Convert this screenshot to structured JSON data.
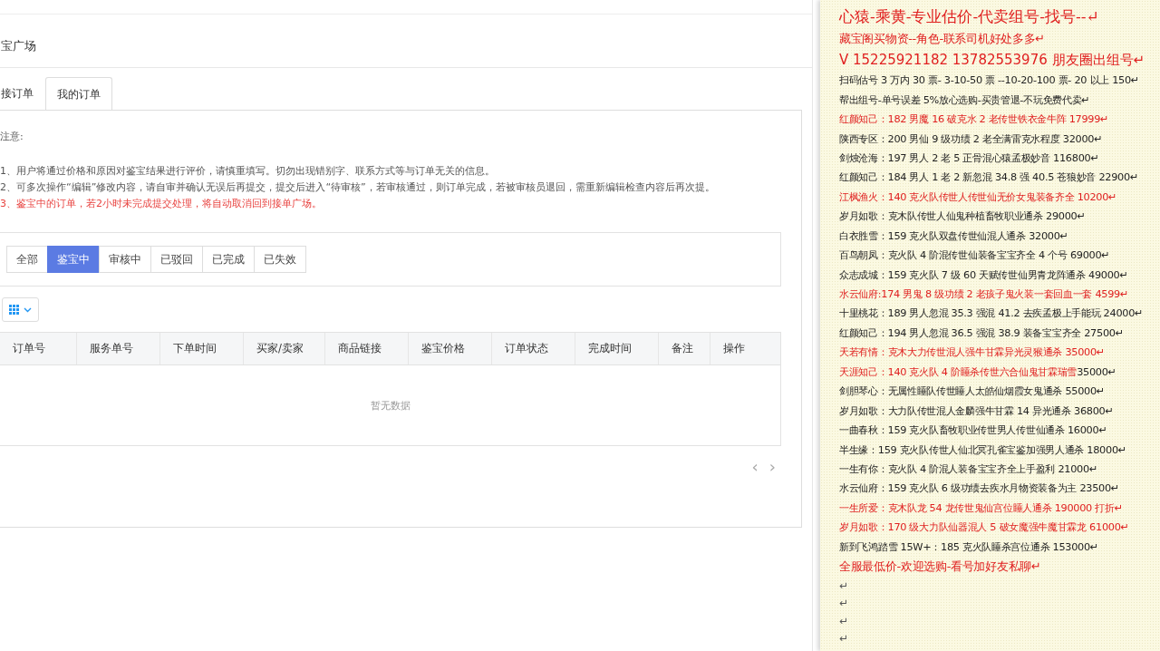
{
  "page": {
    "title": "宝广场"
  },
  "tabs": [
    {
      "label": "接订单",
      "selected": false
    },
    {
      "label": "我的订单",
      "selected": true
    }
  ],
  "notice": {
    "heading": "注意:",
    "items": [
      {
        "text": "1、用户将通过价格和原因对鉴宝结果进行评价，请慎重填写。切勿出现错别字、联系方式等与订单无关的信息。",
        "kind": "normal"
      },
      {
        "text": "2、可多次操作“编辑”修改内容，请自审并确认无误后再提交，提交后进入“待审核”，若审核通过，则订单完成，若被审核员退回，需重新编辑检查内容后再次提。",
        "kind": "normal"
      },
      {
        "text": "3、鉴宝中的订单，若2小时未完成提交处理，将自动取消回到接单广场。",
        "kind": "warning"
      }
    ]
  },
  "filters": [
    {
      "label": "全部",
      "selected": false
    },
    {
      "label": "鉴宝中",
      "selected": true
    },
    {
      "label": "审核中",
      "selected": false
    },
    {
      "label": "已驳回",
      "selected": false
    },
    {
      "label": "已完成",
      "selected": false
    },
    {
      "label": "已失效",
      "selected": false
    }
  ],
  "table": {
    "columns": [
      "订单号",
      "服务单号",
      "下单时间",
      "买家/卖家",
      "商品链接",
      "鉴宝价格",
      "订单状态",
      "完成时间",
      "备注",
      "操作"
    ],
    "empty_text": "暂无数据"
  },
  "pager": {
    "prev": "‹",
    "next": "›",
    "disabled": true
  },
  "document": {
    "lines": [
      {
        "text": "心猿-乘黄-专业估价-代卖组号-找号--↵",
        "color": "#e02020",
        "kind": "title"
      },
      {
        "text": "藏宝阁买物资--角色-联系司机好处多多↵",
        "color": "#e02020",
        "kind": "medium"
      },
      {
        "text": "V 15225921182    13782553976 朋友圈出组号↵",
        "color": "#e02020",
        "kind": "large"
      },
      {
        "text": "扫码估号 3 万内 30 票- 3-10-50 票  --10-20-100 票- 20 以上 150↵",
        "color": "#222222",
        "kind": "body"
      },
      {
        "text": "帮出组号-单号误差 5%放心选购-买贵管退-不玩免费代卖↵",
        "color": "#222222",
        "kind": "body"
      },
      {
        "text": "红颜知己：182 男魔 16 破克水 2 老传世铁衣金牛阵 17999↵",
        "color": "#e02020",
        "kind": "body"
      },
      {
        "text": "陕西专区：200 男仙 9 级功绩 2 老全满雷克水程度 32000↵",
        "color": "#222222",
        "kind": "body"
      },
      {
        "text": "剑烛沧海：197 男人 2 老 5 正骨混心猿孟极妙音 116800↵",
        "color": "#222222",
        "kind": "body"
      },
      {
        "text": "红颜知己：184 男人 1 老 2 新忽混 34.8 强 40.5 苍狼妙音 22900↵",
        "color": "#222222",
        "kind": "body"
      },
      {
        "text": "江枫渔火：140 克火队传世人传世仙无价女鬼装备齐全 10200↵",
        "color": "#e02020",
        "kind": "body"
      },
      {
        "text": "岁月如歌：克木队传世人仙鬼种植畜牧职业通杀 29000↵",
        "color": "#222222",
        "kind": "body"
      },
      {
        "text": "白衣胜雪：159 克火队双盘传世仙混人通杀 32000↵",
        "color": "#222222",
        "kind": "body"
      },
      {
        "text": "百鸟朝凤：克火队 4 阶混传世仙装备宝宝齐全 4 个号 69000↵",
        "color": "#222222",
        "kind": "body"
      },
      {
        "text": "众志成城：159 克火队 7 级 60 天赋传世仙男青龙阵通杀 49000↵",
        "color": "#222222",
        "kind": "body"
      },
      {
        "text": "水云仙府:174 男鬼 8 级功绩 2 老孩子鬼火装一套回血一套 4599↵",
        "color": "#e02020",
        "kind": "body"
      },
      {
        "text": "十里桃花：189 男人忽混 35.3 强混 41.2 去疾孟极上手能玩 24000↵",
        "color": "#222222",
        "kind": "body"
      },
      {
        "text": "红颜知己：194 男人忽混 36.5 强混 38.9 装备宝宝齐全 27500↵",
        "color": "#222222",
        "kind": "body"
      },
      {
        "text": "天若有情：克木大力传世混人强牛甘霖异光灵猴通杀 35000↵",
        "color": "#e02020",
        "kind": "body"
      },
      {
        "text": "天涯知己：140 克火队 4 阶睡杀传世六合仙鬼甘霖瑞雪",
        "color": "#e02020",
        "kind": "body",
        "tail": {
          "text": " 35000↵",
          "color": "#222222"
        }
      },
      {
        "text": "剑胆琴心：无属性睡队传世睡人太皓仙烟霞女鬼通杀 55000↵",
        "color": "#222222",
        "kind": "body"
      },
      {
        "text": "岁月如歌：大力队传世混人金麟强牛甘霖 14 异光通杀 36800↵",
        "color": "#222222",
        "kind": "body"
      },
      {
        "text": "一曲春秋：159 克火队畜牧职业传世男人传世仙通杀 16000↵",
        "color": "#222222",
        "kind": "body"
      },
      {
        "text": "半生缘：159 克火队传世人仙北冥孔雀宝鉴加强男人通杀 18000↵",
        "color": "#222222",
        "kind": "body"
      },
      {
        "text": "一生有你：克火队 4 阶混人装备宝宝齐全上手盈利 21000↵",
        "color": "#222222",
        "kind": "body"
      },
      {
        "text": "水云仙府：159 克火队 6 级功绩去疾水月物资装备为主 23500↵",
        "color": "#222222",
        "kind": "body"
      },
      {
        "text": "一生所爱：克木队龙 54 龙传世鬼仙宫位睡人通杀 190000 打折↵",
        "color": "#e02020",
        "kind": "body"
      },
      {
        "text": "岁月如歌：170 级大力队仙器混人 5 破女魔强牛魔甘霖龙 61000↵",
        "color": "#e02020",
        "kind": "body"
      },
      {
        "text": "新到飞鸿踏雪 15W+：185 克火队睡杀宫位通杀 153000↵",
        "color": "#222222",
        "kind": "body"
      },
      {
        "text": "全服最低价-欢迎选购-看号加好友私聊↵",
        "color": "#e02020",
        "kind": "medium"
      },
      {
        "text": "↵",
        "color": "#555555",
        "kind": "mark"
      },
      {
        "text": "↵",
        "color": "#555555",
        "kind": "mark"
      },
      {
        "text": "↵",
        "color": "#555555",
        "kind": "mark"
      },
      {
        "text": "↵",
        "color": "#555555",
        "kind": "mark"
      }
    ]
  }
}
